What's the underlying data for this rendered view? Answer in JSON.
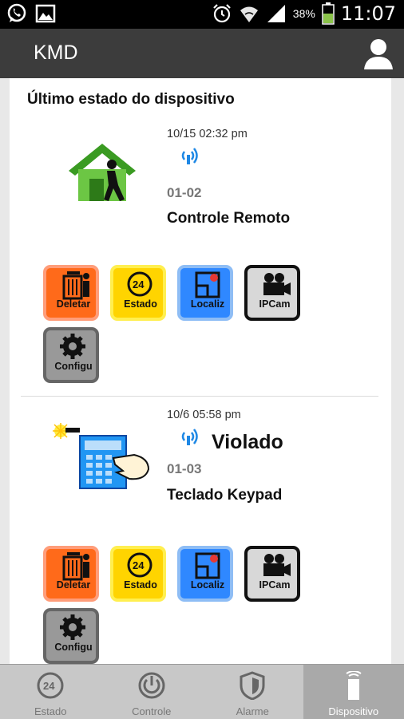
{
  "status_bar": {
    "time": "11:07",
    "battery": "38%",
    "icons": [
      "whatsapp-icon",
      "image-icon",
      "alarm-icon",
      "wifi-icon",
      "signal-icon",
      "battery-icon"
    ]
  },
  "app_bar": {
    "title": "KMD",
    "account_icon": "account-icon"
  },
  "section_title": "Último estado do dispositivo",
  "devices": [
    {
      "icon": "house-person-icon",
      "timestamp": "10/15 02:32 pm",
      "status": "",
      "code": "01-02",
      "name": "Controle Remoto",
      "actions": [
        {
          "label": "Deletar",
          "icon": "trash-icon"
        },
        {
          "label": "Estado",
          "icon": "24hr-icon"
        },
        {
          "label": "Localiz",
          "icon": "location-map-icon"
        },
        {
          "label": "IPCam",
          "icon": "camera-icon"
        },
        {
          "label": "Configu",
          "icon": "gear-icon"
        }
      ]
    },
    {
      "icon": "keypad-hand-icon",
      "timestamp": "10/6 05:58 pm",
      "status": "Violado",
      "code": "01-03",
      "name": "Teclado Keypad",
      "actions": [
        {
          "label": "Deletar",
          "icon": "trash-icon"
        },
        {
          "label": "Estado",
          "icon": "24hr-icon"
        },
        {
          "label": "Localiz",
          "icon": "location-map-icon"
        },
        {
          "label": "IPCam",
          "icon": "camera-icon"
        },
        {
          "label": "Configu",
          "icon": "gear-icon"
        }
      ]
    }
  ],
  "bottom_nav": [
    {
      "label": "Estado",
      "icon": "24hr-icon",
      "active": false
    },
    {
      "label": "Controle",
      "icon": "power-icon",
      "active": false
    },
    {
      "label": "Alarme",
      "icon": "shield-icon",
      "active": false
    },
    {
      "label": "Dispositivo",
      "icon": "sensor-device-icon",
      "active": true
    }
  ],
  "colors": {
    "action_bar": "#3c3c3c",
    "delete": "#ff6a1a",
    "state": "#ffd400",
    "locate": "#2f88ff",
    "ipcam": "#d8d8d8",
    "config": "#999999",
    "signal": "#1e88e5"
  }
}
